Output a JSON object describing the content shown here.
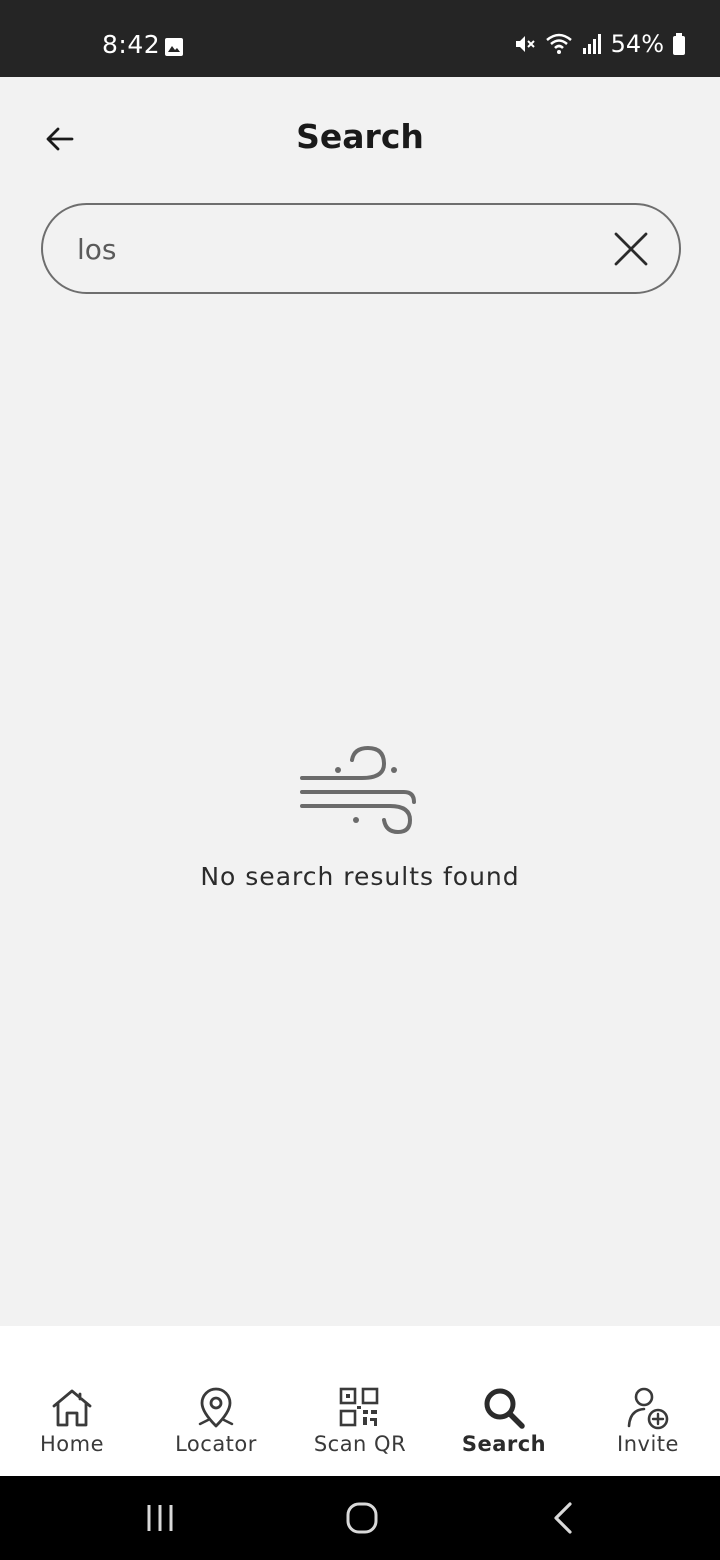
{
  "status_bar": {
    "time": "8:42",
    "battery": "54%",
    "icons": [
      "image-icon",
      "mute-icon",
      "wifi-icon",
      "signal-icon",
      "battery-icon"
    ]
  },
  "header": {
    "title": "Search",
    "back_icon": "arrow-left-icon"
  },
  "search": {
    "value": "los",
    "clear_icon": "close-icon"
  },
  "empty_state": {
    "icon": "wind-icon",
    "message": "No search results found"
  },
  "bottom_nav": {
    "items": [
      {
        "label": "Home",
        "icon": "home-icon",
        "active": false
      },
      {
        "label": "Locator",
        "icon": "location-pin-icon",
        "active": false
      },
      {
        "label": "Scan QR",
        "icon": "qr-code-icon",
        "active": false
      },
      {
        "label": "Search",
        "icon": "search-icon",
        "active": true
      },
      {
        "label": "Invite",
        "icon": "add-user-icon",
        "active": false
      }
    ]
  },
  "colors": {
    "status_bar_bg": "#252525",
    "page_bg": "#f2f2f2",
    "text_primary": "#1a1a1a",
    "nav_bg": "#ffffff",
    "system_nav_bg": "#000000"
  }
}
